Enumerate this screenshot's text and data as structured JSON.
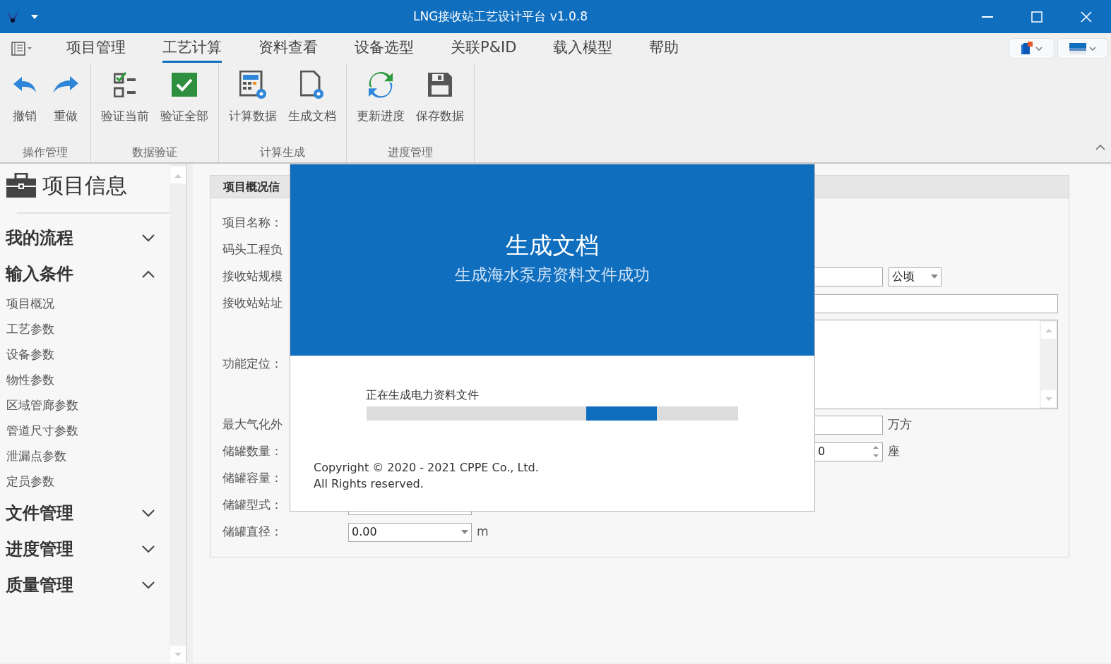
{
  "window": {
    "title": "LNG接收站工艺设计平台 v1.0.8"
  },
  "menu_tabs": [
    {
      "label": "项目管理",
      "selected": false
    },
    {
      "label": "工艺计算",
      "selected": true
    },
    {
      "label": "资料查看",
      "selected": false
    },
    {
      "label": "设备选型",
      "selected": false
    },
    {
      "label": "关联P&ID",
      "selected": false
    },
    {
      "label": "载入模型",
      "selected": false
    },
    {
      "label": "帮助",
      "selected": false
    }
  ],
  "ribbon_groups": [
    {
      "label": "操作管理",
      "buttons": [
        {
          "label": "撤销"
        },
        {
          "label": "重做"
        }
      ]
    },
    {
      "label": "数据验证",
      "buttons": [
        {
          "label": "验证当前"
        },
        {
          "label": "验证全部"
        }
      ]
    },
    {
      "label": "计算生成",
      "buttons": [
        {
          "label": "计算数据"
        },
        {
          "label": "生成文档"
        }
      ]
    },
    {
      "label": "进度管理",
      "buttons": [
        {
          "label": "更新进度"
        },
        {
          "label": "保存数据"
        }
      ]
    }
  ],
  "sidebar": {
    "title": "项目信息",
    "sections": [
      {
        "label": "我的流程",
        "expanded": false
      },
      {
        "label": "输入条件",
        "expanded": true,
        "items": [
          "项目概况",
          "工艺参数",
          "设备参数",
          "物性参数",
          "区域管廊参数",
          "管道尺寸参数",
          "泄漏点参数",
          "定员参数"
        ]
      },
      {
        "label": "文件管理",
        "expanded": false
      },
      {
        "label": "进度管理",
        "expanded": false
      },
      {
        "label": "质量管理",
        "expanded": false
      }
    ]
  },
  "panel": {
    "title": "项目概况信",
    "fields": [
      {
        "label": "项目名称：",
        "kind": "none"
      },
      {
        "label": "码头工程负",
        "kind": "none"
      },
      {
        "label": "接收站规模",
        "kind": "text_select",
        "unit": "公顷"
      },
      {
        "label": "接收站站址",
        "kind": "wide"
      },
      {
        "label": "功能定位：",
        "kind": "textarea"
      },
      {
        "label": "最大气化外",
        "kind": "text",
        "unit": "万方"
      },
      {
        "label": "储罐数量：",
        "kind": "spin",
        "value": "0",
        "unit": "座"
      },
      {
        "label": "储罐容量：",
        "kind": "none"
      },
      {
        "label": "储罐型式：",
        "kind": "short"
      },
      {
        "label": "储罐直径：",
        "kind": "select",
        "value": "0.00",
        "unit": "m"
      }
    ]
  },
  "dialog": {
    "title": "生成文档",
    "message": "生成海水泵房资料文件成功",
    "progress_label": "正在生成电力资料文件",
    "copyright": [
      "Copyright © 2020 - 2021 CPPE Co., Ltd.",
      "All Rights reserved."
    ]
  }
}
